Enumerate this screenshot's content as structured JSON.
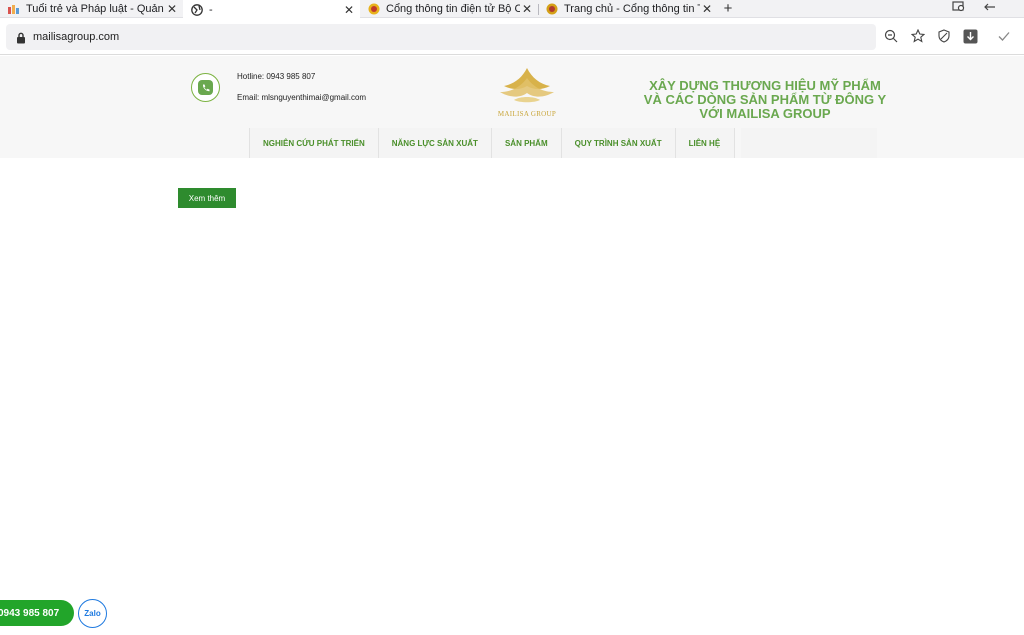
{
  "browser": {
    "tabs": [
      {
        "title": "Tuổi trẻ và Pháp luật - Quản",
        "close": "✕"
      },
      {
        "title": "-",
        "close": "✕"
      },
      {
        "title": "Cổng thông tin điện tử Bộ Cô",
        "close": "✕"
      },
      {
        "title": "Trang chủ - Cổng thông tin T",
        "close": "✕"
      }
    ],
    "new_tab": "+",
    "url": "mailisagroup.com"
  },
  "header": {
    "hotline": "Hotline: 0943 985 807",
    "email": "Email: mlsnguyenthimai@gmail.com",
    "logo_text": "MAILISA GROUP",
    "slogan": "XÂY DỰNG THƯƠNG HIỆU MỸ PHẨM VÀ CÁC DÒNG SẢN PHẨM TỪ ĐÔNG Y VỚI MAILISA GROUP"
  },
  "nav": {
    "items": [
      {
        "label": "NGHIÊN CỨU PHÁT TRIỂN"
      },
      {
        "label": "NĂNG LỰC SẢN XUẤT"
      },
      {
        "label": "SẢN PHẨM"
      },
      {
        "label": "QUY TRÌNH SẢN XUẤT"
      },
      {
        "label": "LIÊN HỆ"
      }
    ]
  },
  "main": {
    "more_button": "Xem thêm"
  },
  "floating": {
    "phone": "0943 985 807",
    "zalo": "Zalo"
  },
  "colors": {
    "brand_green": "#6aa84f",
    "button_green": "#2e8b2e",
    "logo_gold": "#c9a63b"
  }
}
